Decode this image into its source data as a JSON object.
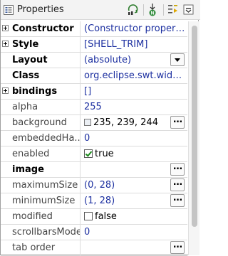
{
  "panel": {
    "title": "Properties",
    "toolbar": [
      "show-events-icon",
      "goto-definition-icon",
      "show-advanced-icon",
      "collapse-icon"
    ]
  },
  "properties": [
    {
      "name": "Constructor",
      "value": "(Constructor properties)",
      "bold": true,
      "expandable": true,
      "editor": "none"
    },
    {
      "name": "Style",
      "value": "[SHELL_TRIM]",
      "bold": true,
      "expandable": true,
      "editor": "none"
    },
    {
      "name": "Layout",
      "value": "(absolute)",
      "bold": true,
      "expandable": false,
      "editor": "dropdown"
    },
    {
      "name": "Class",
      "value": "org.eclipse.swt.widgets.Shell",
      "bold": true,
      "expandable": false,
      "editor": "none"
    },
    {
      "name": "bindings",
      "value": "[]",
      "bold": true,
      "expandable": true,
      "editor": "none"
    },
    {
      "name": "alpha",
      "value": "255",
      "bold": false,
      "expandable": false,
      "editor": "none"
    },
    {
      "name": "background",
      "value": "235, 239, 244",
      "bold": false,
      "expandable": false,
      "editor": "dots",
      "swatch": "#ebeff4"
    },
    {
      "name": "embeddedHa...",
      "value": "0",
      "bold": false,
      "expandable": false,
      "editor": "none"
    },
    {
      "name": "enabled",
      "value": "true",
      "bold": false,
      "expandable": false,
      "editor": "checkbox",
      "checked": true
    },
    {
      "name": "image",
      "value": "",
      "bold": true,
      "expandable": false,
      "editor": "dots"
    },
    {
      "name": "maximumSize",
      "value": "(0, 28)",
      "bold": false,
      "expandable": false,
      "editor": "dots"
    },
    {
      "name": "minimumSize",
      "value": "(1, 28)",
      "bold": false,
      "expandable": false,
      "editor": "dots"
    },
    {
      "name": "modified",
      "value": "false",
      "bold": false,
      "expandable": false,
      "editor": "checkbox",
      "checked": false
    },
    {
      "name": "scrollbarsMode",
      "value": "0",
      "bold": false,
      "expandable": false,
      "editor": "none"
    },
    {
      "name": "tab order",
      "value": "",
      "bold": false,
      "expandable": false,
      "editor": "dots"
    }
  ],
  "colors": {
    "value_text": "#1c2fa0",
    "checkbox_check": "#1c8a1c"
  },
  "scroll": {
    "position": 0,
    "visible_fraction": 0.88
  }
}
